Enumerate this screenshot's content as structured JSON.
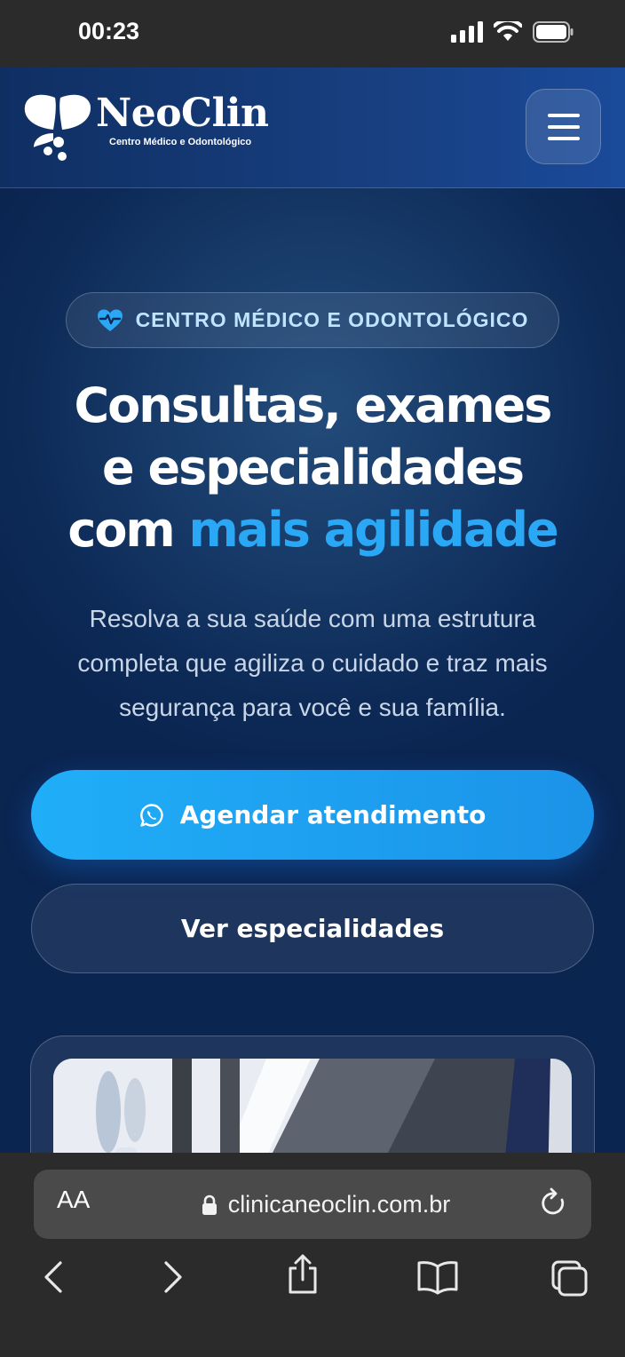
{
  "status_bar": {
    "time": "00:23"
  },
  "header": {
    "logo_name": "NeoClin",
    "logo_tagline": "Centro Médico e Odontológico"
  },
  "hero": {
    "badge": "CENTRO MÉDICO E ODONTOLÓGICO",
    "title_line1": "Consultas, exames",
    "title_line2": "e especialidades",
    "title_line3_plain": "com",
    "title_line3_accent": "mais agilidade",
    "subtitle": "Resolva a sua saúde com uma estrutura completa que agiliza o cuidado e traz mais segurança para você e sua família.",
    "cta_primary": "Agendar atendimento",
    "cta_secondary": "Ver especialidades"
  },
  "browser": {
    "text_size_label": "AA",
    "url": "clinicaneoclin.com.br"
  },
  "colors": {
    "accent": "#2aa8f5",
    "header_bg": "#183f80",
    "page_bg": "#0d2a57",
    "browser_chrome": "#2b2b2b"
  }
}
